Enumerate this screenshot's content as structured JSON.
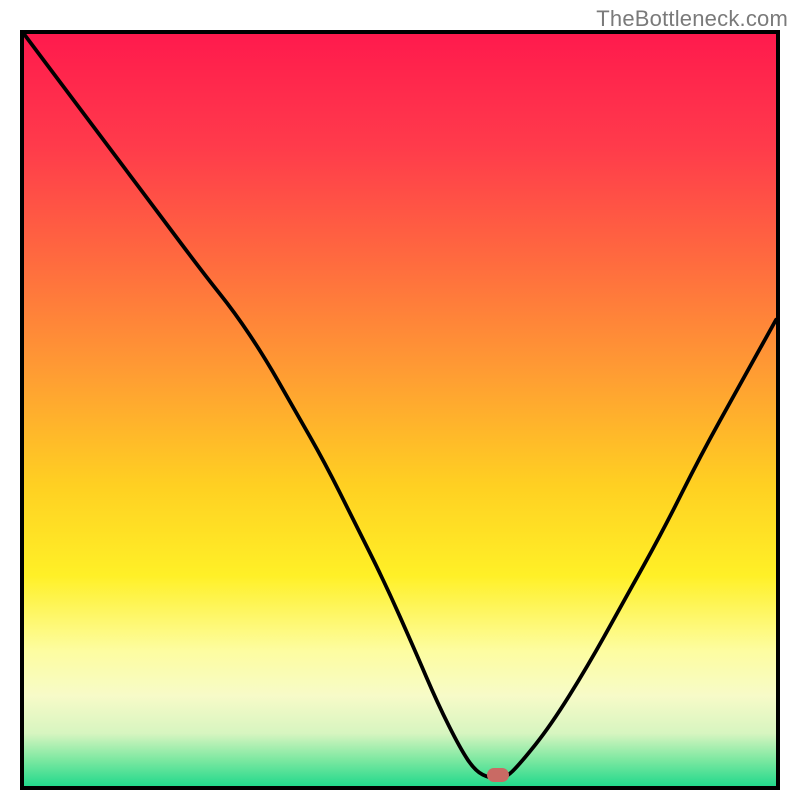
{
  "watermark": "TheBottleneck.com",
  "gradient": {
    "stops": [
      {
        "offset": 0.0,
        "color": "#ff1a4d"
      },
      {
        "offset": 0.15,
        "color": "#ff3b4b"
      },
      {
        "offset": 0.3,
        "color": "#ff6a3f"
      },
      {
        "offset": 0.45,
        "color": "#ff9c33"
      },
      {
        "offset": 0.6,
        "color": "#ffd022"
      },
      {
        "offset": 0.72,
        "color": "#fff027"
      },
      {
        "offset": 0.82,
        "color": "#fdfda0"
      },
      {
        "offset": 0.88,
        "color": "#f7fbc8"
      },
      {
        "offset": 0.93,
        "color": "#d7f5c0"
      },
      {
        "offset": 0.965,
        "color": "#7de8a1"
      },
      {
        "offset": 1.0,
        "color": "#23d98c"
      }
    ]
  },
  "marker": {
    "x_pct": 63.0,
    "y_pct": 98.5
  },
  "chart_data": {
    "type": "line",
    "title": "",
    "xlabel": "",
    "ylabel": "",
    "xlim": [
      0,
      100
    ],
    "ylim": [
      0,
      100
    ],
    "series": [
      {
        "name": "bottleneck-curve",
        "x": [
          0,
          6,
          12,
          18,
          24,
          28,
          32,
          36,
          40,
          44,
          48,
          52,
          55,
          58,
          60,
          62,
          64,
          66,
          70,
          75,
          80,
          85,
          90,
          95,
          100
        ],
        "y": [
          100,
          92,
          84,
          76,
          68,
          63,
          57,
          50,
          43,
          35,
          27,
          18,
          11,
          5,
          2,
          1,
          1,
          3,
          8,
          16,
          25,
          34,
          44,
          53,
          62
        ]
      }
    ],
    "annotations": [
      {
        "text": "TheBottleneck.com",
        "role": "watermark"
      }
    ],
    "marker_point": {
      "x": 63,
      "y": 1.5
    }
  }
}
